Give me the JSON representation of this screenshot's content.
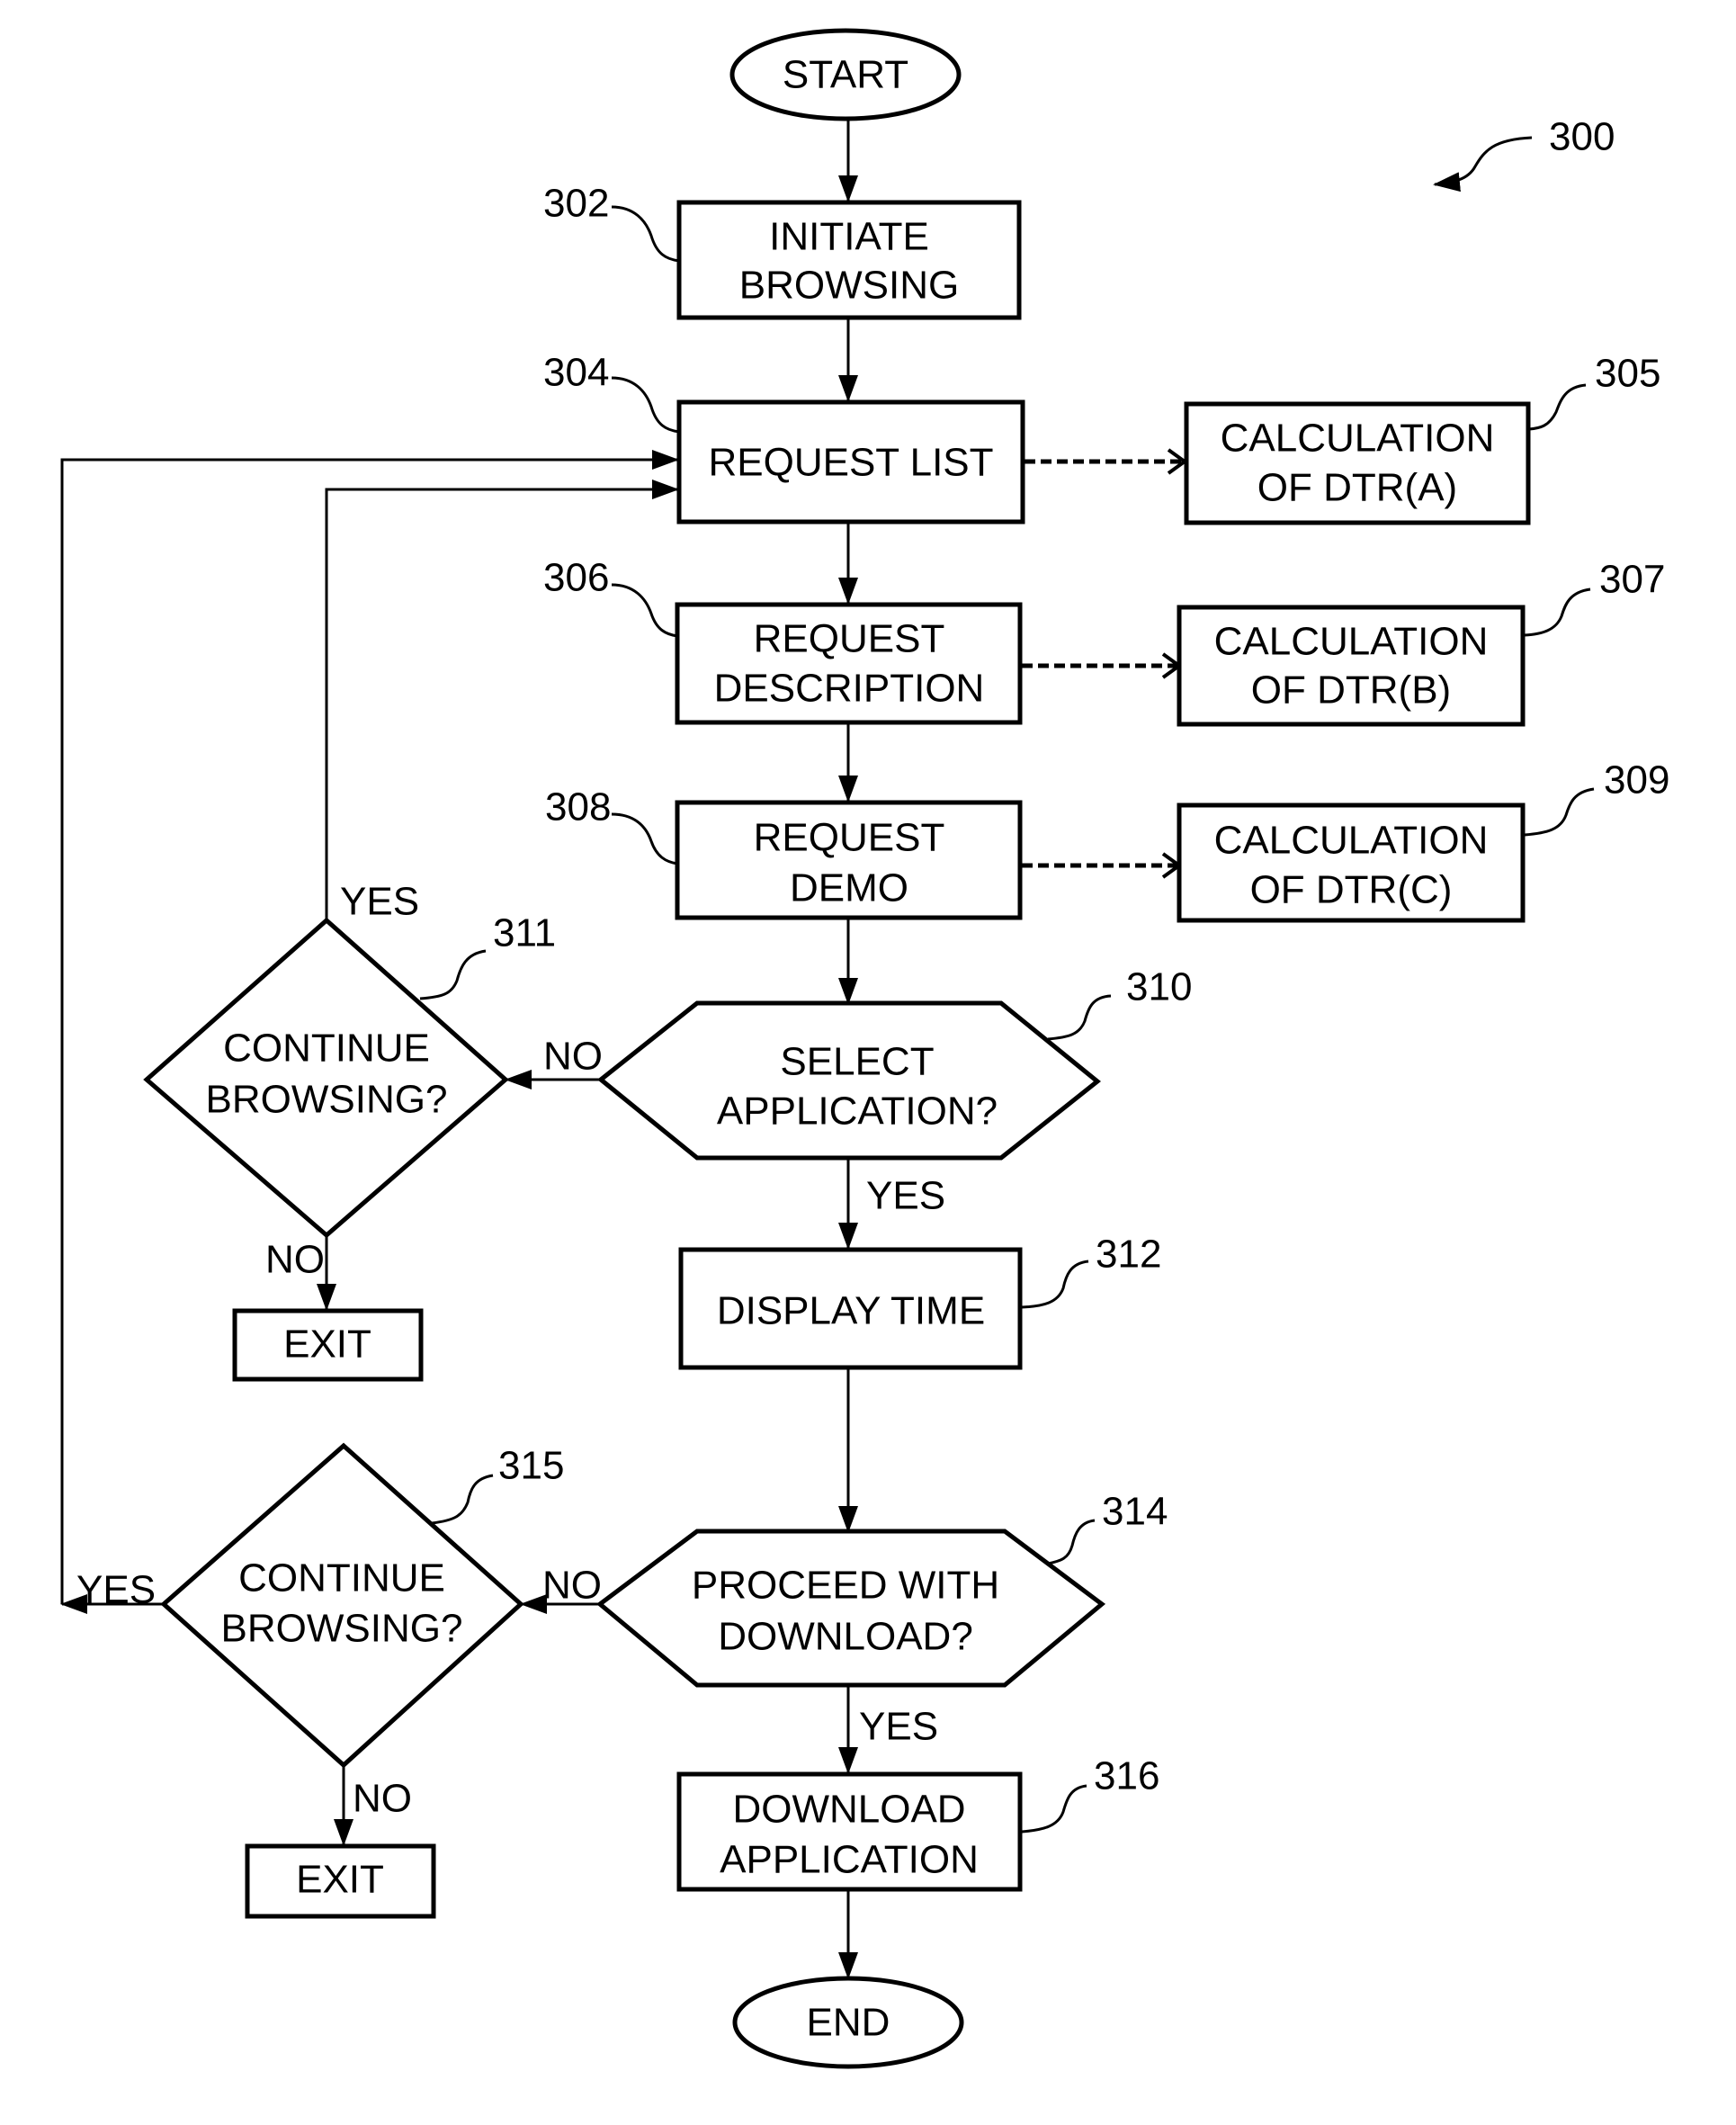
{
  "figure": {
    "reference": "300",
    "nodes": {
      "start": {
        "text": [
          "START"
        ]
      },
      "n302": {
        "ref": "302",
        "text": [
          "INITIATE",
          "BROWSING"
        ]
      },
      "n304": {
        "ref": "304",
        "text": [
          "REQUEST LIST"
        ]
      },
      "n305": {
        "ref": "305",
        "text": [
          "CALCULATION",
          "OF DTR(A)"
        ]
      },
      "n306": {
        "ref": "306",
        "text": [
          "REQUEST",
          "DESCRIPTION"
        ]
      },
      "n307": {
        "ref": "307",
        "text": [
          "CALCULATION",
          "OF DTR(B)"
        ]
      },
      "n308": {
        "ref": "308",
        "text": [
          "REQUEST",
          "DEMO"
        ]
      },
      "n309": {
        "ref": "309",
        "text": [
          "CALCULATION",
          "OF DTR(C)"
        ]
      },
      "n310": {
        "ref": "310",
        "text": [
          "SELECT",
          "APPLICATION?"
        ]
      },
      "n311": {
        "ref": "311",
        "text": [
          "CONTINUE",
          "BROWSING?"
        ]
      },
      "exit1": {
        "text": [
          "EXIT"
        ]
      },
      "n312": {
        "ref": "312",
        "text": [
          "DISPLAY TIME"
        ]
      },
      "n314": {
        "ref": "314",
        "text": [
          "PROCEED WITH",
          "DOWNLOAD?"
        ]
      },
      "n315": {
        "ref": "315",
        "text": [
          "CONTINUE",
          "BROWSING?"
        ]
      },
      "exit2": {
        "text": [
          "EXIT"
        ]
      },
      "n316": {
        "ref": "316",
        "text": [
          "DOWNLOAD",
          "APPLICATION"
        ]
      },
      "end": {
        "text": [
          "END"
        ]
      }
    },
    "edge_labels": {
      "e311_yes": "YES",
      "e310_no": "NO",
      "e311_no": "NO",
      "e310_yes": "YES",
      "e315_yes": "YES",
      "e314_no": "NO",
      "e314_yes": "YES",
      "e315_no": "NO"
    }
  }
}
